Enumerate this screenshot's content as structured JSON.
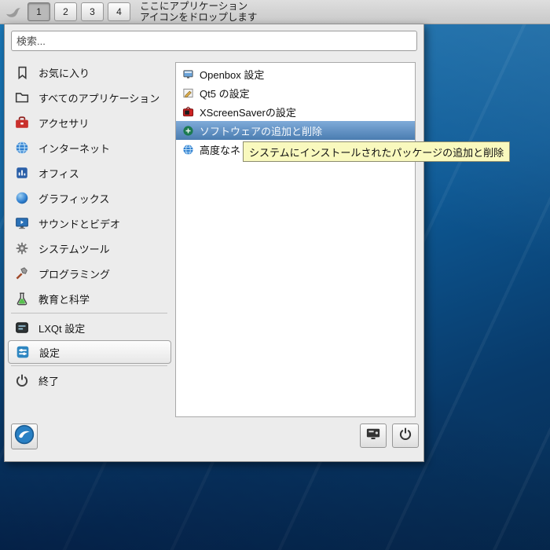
{
  "taskbar": {
    "workspaces": [
      {
        "label": "1",
        "active": true
      },
      {
        "label": "2",
        "active": false
      },
      {
        "label": "3",
        "active": false
      },
      {
        "label": "4",
        "active": false
      }
    ],
    "drop_hint_line1": "ここにアプリケーション",
    "drop_hint_line2": "アイコンをドロップします"
  },
  "menu": {
    "search_placeholder": "検索...",
    "categories": [
      {
        "label": "お気に入り",
        "icon": "bookmark-icon"
      },
      {
        "label": "すべてのアプリケーション",
        "icon": "folder-icon"
      },
      {
        "label": "アクセサリ",
        "icon": "toolbox-icon"
      },
      {
        "label": "インターネット",
        "icon": "globe-icon"
      },
      {
        "label": "オフィス",
        "icon": "office-icon"
      },
      {
        "label": "グラフィックス",
        "icon": "sphere-icon"
      },
      {
        "label": "サウンドとビデオ",
        "icon": "monitor-icon"
      },
      {
        "label": "システムツール",
        "icon": "gear-icon"
      },
      {
        "label": "プログラミング",
        "icon": "tools-icon"
      },
      {
        "label": "教育と科学",
        "icon": "flask-icon"
      },
      {
        "label": "LXQt 設定",
        "icon": "lxqt-settings-icon"
      },
      {
        "label": "設定",
        "icon": "settings-icon",
        "selected": true
      },
      {
        "label": "終了",
        "icon": "power-icon"
      }
    ],
    "apps": [
      {
        "label": "Openbox 設定",
        "icon": "openbox-icon"
      },
      {
        "label": "Qt5 の設定",
        "icon": "qt5-icon"
      },
      {
        "label": "XScreenSaverの設定",
        "icon": "xscreensaver-icon"
      },
      {
        "label": "ソフトウェアの追加と削除",
        "icon": "software-icon",
        "selected": true
      },
      {
        "label": "高度なネ",
        "icon": "network-icon"
      }
    ],
    "tooltip": "システムにインストールされたパッケージの追加と削除"
  },
  "colors": {
    "selection_blue": "#4a7cb0",
    "tooltip_bg": "#f9f9be",
    "panel_gray": "#d2d2d2",
    "menu_gray": "#ececec"
  }
}
